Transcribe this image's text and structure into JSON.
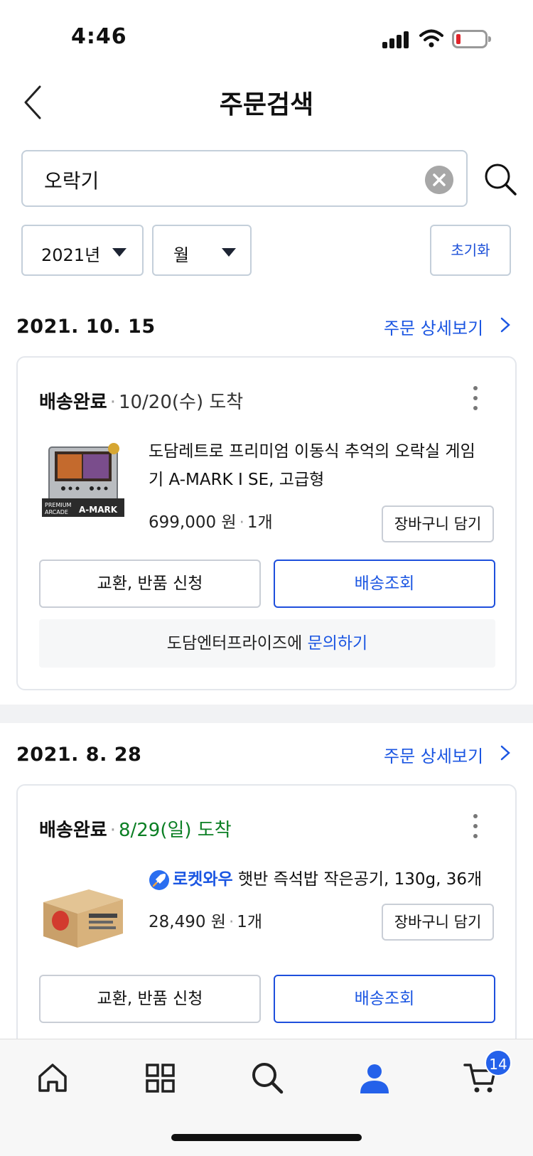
{
  "status_bar": {
    "time": "4:46"
  },
  "header": {
    "title": "주문검색"
  },
  "search": {
    "value": "오락기"
  },
  "filters": {
    "year": "2021년",
    "month": "월",
    "reset_label": "초기화"
  },
  "orders": [
    {
      "date": "2021. 10. 15",
      "detail_link": "주문 상세보기",
      "status": "배송완료",
      "arrival": "10/20(수) 도착",
      "product_name": "도담레트로 프리미엄 이동식 추억의 오락실 게임기 A-MARK I SE, 고급형",
      "price": "699,000 원",
      "quantity": "1개",
      "cart_label": "장바구니 담기",
      "return_label": "교환, 반품 신청",
      "track_label": "배송조회",
      "seller": "도담엔터프라이즈에",
      "inquiry_label": "문의하기",
      "image_text": [
        "PREMIUM",
        "ARCADE",
        "A-MARK"
      ]
    },
    {
      "date": "2021. 8. 28",
      "detail_link": "주문 상세보기",
      "status": "배송완료",
      "arrival": "8/29(일) 도착",
      "arrival_color": "#0b7f24",
      "rocket_label": "로켓와우",
      "product_name": "햇반 즉석밥 작은공기, 130g, 36개",
      "price": "28,490 원",
      "quantity": "1개",
      "cart_label": "장바구니 담기",
      "return_label": "교환, 반품 신청",
      "track_label": "배송조회"
    }
  ],
  "bottom_nav": {
    "items": [
      "home-icon",
      "category-icon",
      "search-icon",
      "my-page-icon",
      "cart-icon"
    ],
    "active": "my-page-icon",
    "active_color": "#2461ea",
    "cart_count": "14"
  }
}
